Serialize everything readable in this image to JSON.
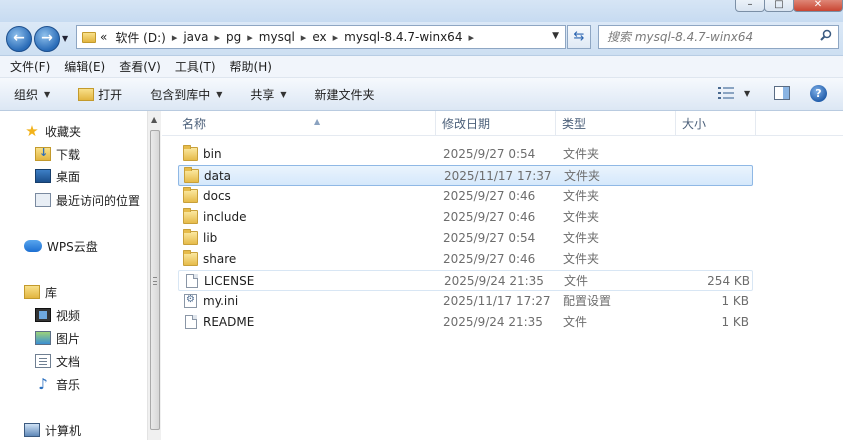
{
  "window": {
    "minimize": "–",
    "maximize": "□",
    "close": "✕"
  },
  "address": {
    "overflow": "«",
    "crumbs": [
      "软件 (D:)",
      "java",
      "pg",
      "mysql",
      "ex",
      "mysql-8.4.7-winx64"
    ]
  },
  "search": {
    "placeholder": "搜索 mysql-8.4.7-winx64"
  },
  "menu": [
    "文件(F)",
    "编辑(E)",
    "查看(V)",
    "工具(T)",
    "帮助(H)"
  ],
  "toolbar": {
    "organize": "组织",
    "open": "打开",
    "include_in_library": "包含到库中",
    "share": "共享",
    "new_folder": "新建文件夹"
  },
  "nav": {
    "favorites": "收藏夹",
    "downloads": "下载",
    "desktop": "桌面",
    "recent": "最近访问的位置",
    "wps_cloud": "WPS云盘",
    "libraries": "库",
    "videos": "视频",
    "pictures": "图片",
    "documents": "文档",
    "music": "音乐",
    "computer": "计算机"
  },
  "columns": {
    "name": "名称",
    "date": "修改日期",
    "type": "类型",
    "size": "大小"
  },
  "files": [
    {
      "name": "bin",
      "date": "2025/9/27 0:54",
      "type": "文件夹",
      "size": "",
      "icon": "folder-icon"
    },
    {
      "name": "data",
      "date": "2025/11/17 17:37",
      "type": "文件夹",
      "size": "",
      "icon": "folder-icon"
    },
    {
      "name": "docs",
      "date": "2025/9/27 0:46",
      "type": "文件夹",
      "size": "",
      "icon": "folder-icon"
    },
    {
      "name": "include",
      "date": "2025/9/27 0:46",
      "type": "文件夹",
      "size": "",
      "icon": "folder-icon"
    },
    {
      "name": "lib",
      "date": "2025/9/27 0:54",
      "type": "文件夹",
      "size": "",
      "icon": "folder-icon"
    },
    {
      "name": "share",
      "date": "2025/9/27 0:46",
      "type": "文件夹",
      "size": "",
      "icon": "folder-icon"
    },
    {
      "name": "LICENSE",
      "date": "2025/9/24 21:35",
      "type": "文件",
      "size": "254 KB",
      "icon": "file-icon"
    },
    {
      "name": "my.ini",
      "date": "2025/11/17 17:27",
      "type": "配置设置",
      "size": "1 KB",
      "icon": "ini-icon"
    },
    {
      "name": "README",
      "date": "2025/9/24 21:35",
      "type": "文件",
      "size": "1 KB",
      "icon": "file-icon"
    }
  ]
}
